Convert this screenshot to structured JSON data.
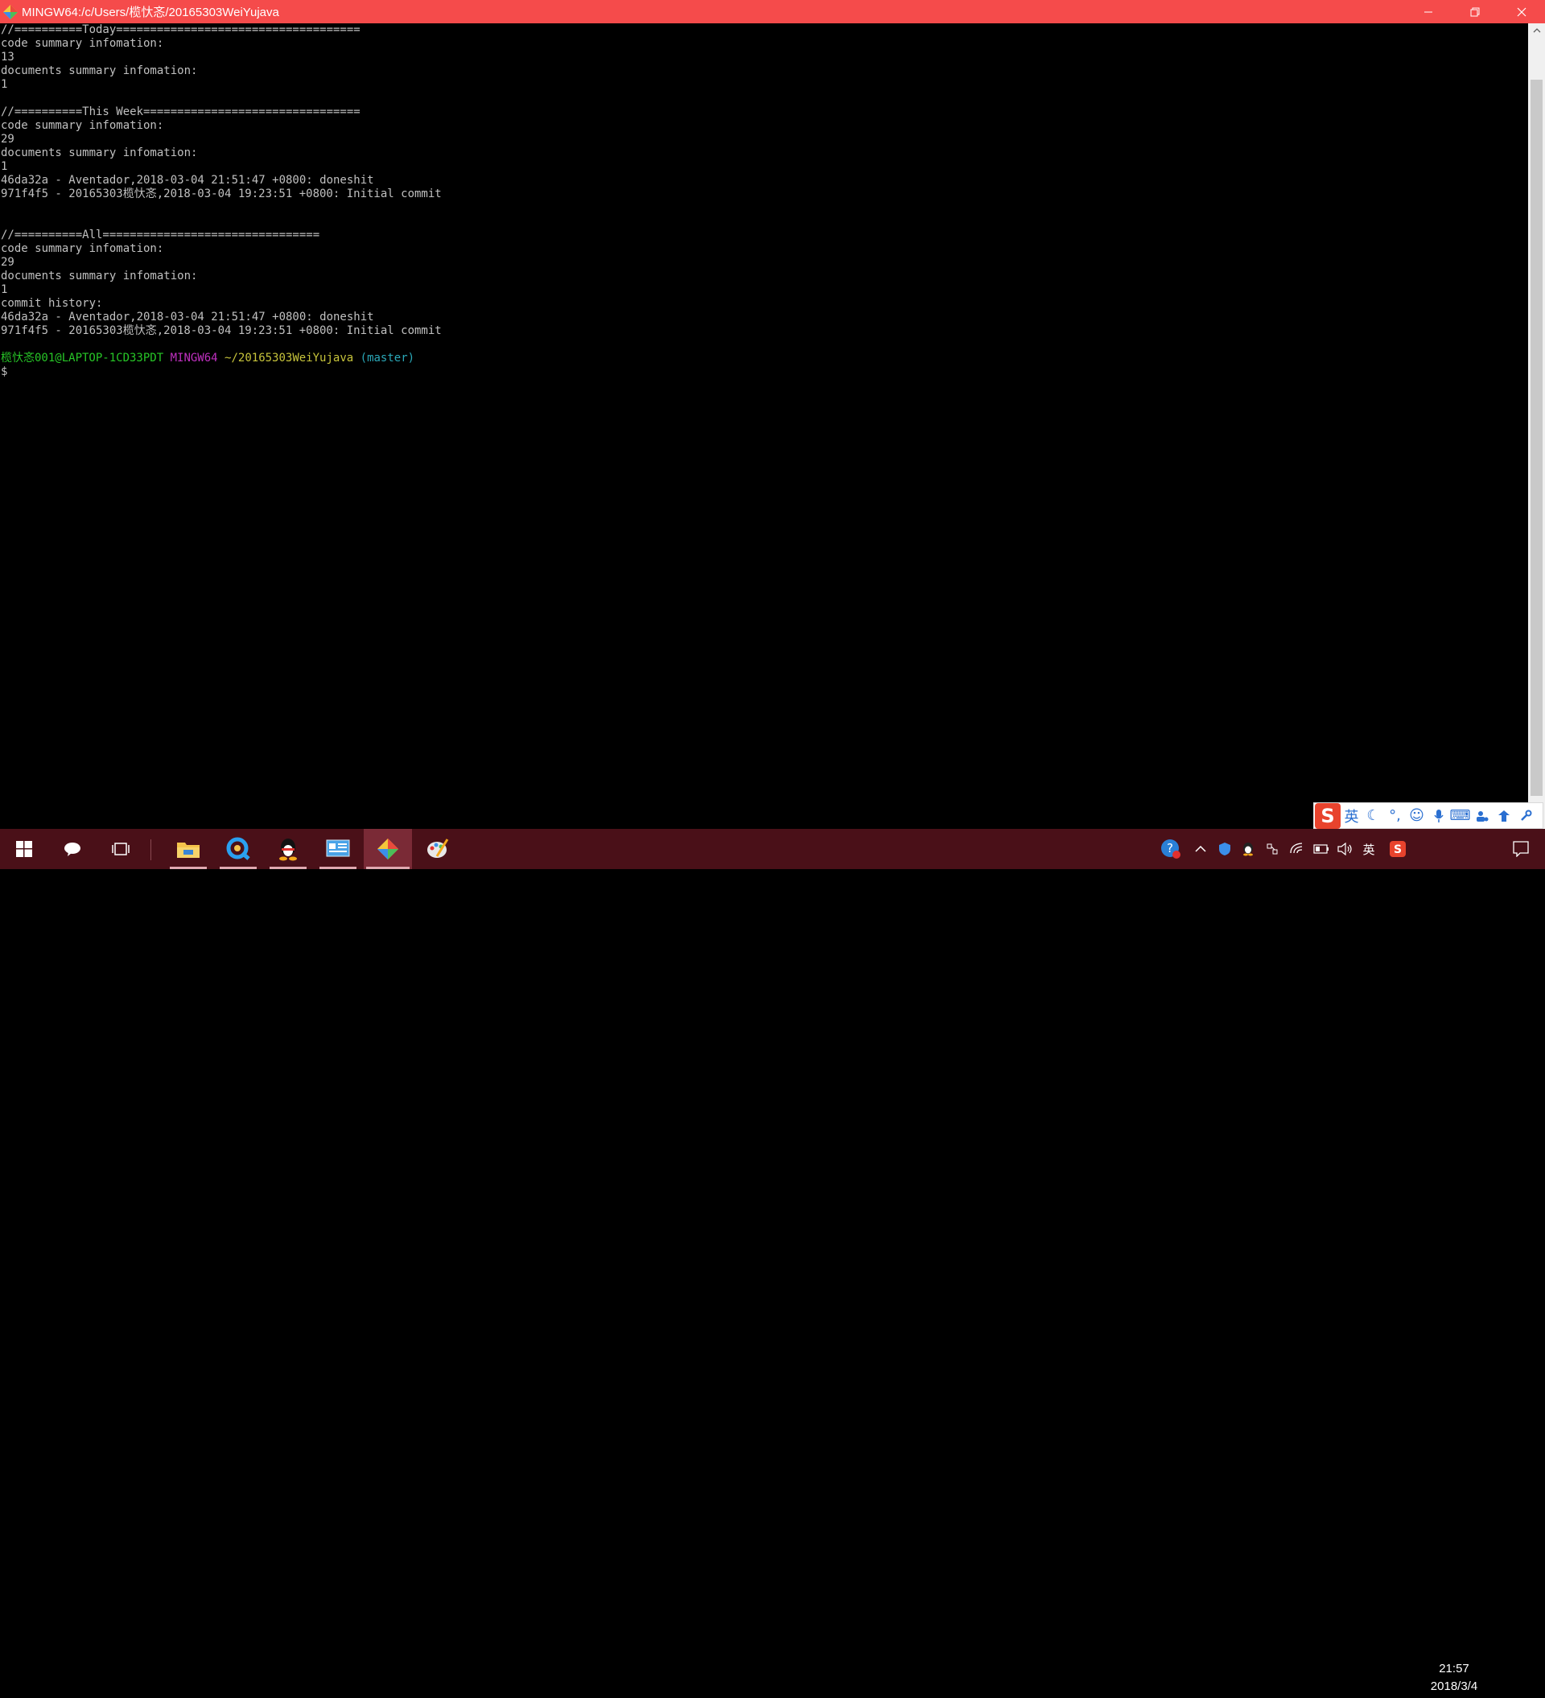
{
  "window": {
    "title": "MINGW64:/c/Users/榄忕忞/20165303WeiYujava",
    "controls": {
      "minimize": "minimize-icon",
      "restore": "restore-icon",
      "close": "close-icon"
    }
  },
  "terminal": {
    "lines": [
      "//==========Today====================================",
      "code summary infomation:",
      "13",
      "documents summary infomation:",
      "1",
      "",
      "//==========This Week================================",
      "code summary infomation:",
      "29",
      "documents summary infomation:",
      "1",
      "46da32a - Aventador,2018-03-04 21:51:47 +0800: doneshit",
      "971f4f5 - 20165303榄忕忞,2018-03-04 19:23:51 +0800: Initial commit",
      "",
      "",
      "//==========All================================",
      "code summary infomation:",
      "29",
      "documents summary infomation:",
      "1",
      "commit history:",
      "46da32a - Aventador,2018-03-04 21:51:47 +0800: doneshit",
      "971f4f5 - 20165303榄忕忞,2018-03-04 19:23:51 +0800: Initial commit",
      ""
    ],
    "prompt": {
      "user_host": "榄忕忞001@LAPTOP-1CD33PDT",
      "shell": "MINGW64",
      "path": "~/20165303WeiYujava",
      "branch": "(master)",
      "symbol": "$"
    }
  },
  "ime": {
    "logo": "S",
    "mode": "英",
    "icons": [
      "moon-icon",
      "punctuation-icon",
      "emoji-icon",
      "microphone-icon",
      "keyboard-icon",
      "user-icon",
      "skin-icon",
      "tools-icon"
    ]
  },
  "taskbar": {
    "apps": [
      "windows-start-icon",
      "cortana-icon",
      "task-view-icon",
      "file-explorer-icon",
      "qq-browser-icon",
      "qq-icon",
      "control-panel-icon",
      "git-bash-icon",
      "paint-icon"
    ],
    "tray": {
      "input_indicator": "英",
      "time": "21:57",
      "date": "2018/3/4"
    }
  },
  "colors": {
    "titlebar": "#f54b4b",
    "taskbar": "#4a1018",
    "prompt_user": "#27c627",
    "prompt_shell": "#c030c0",
    "prompt_path": "#c7c43b",
    "prompt_branch": "#2aa8b8"
  }
}
